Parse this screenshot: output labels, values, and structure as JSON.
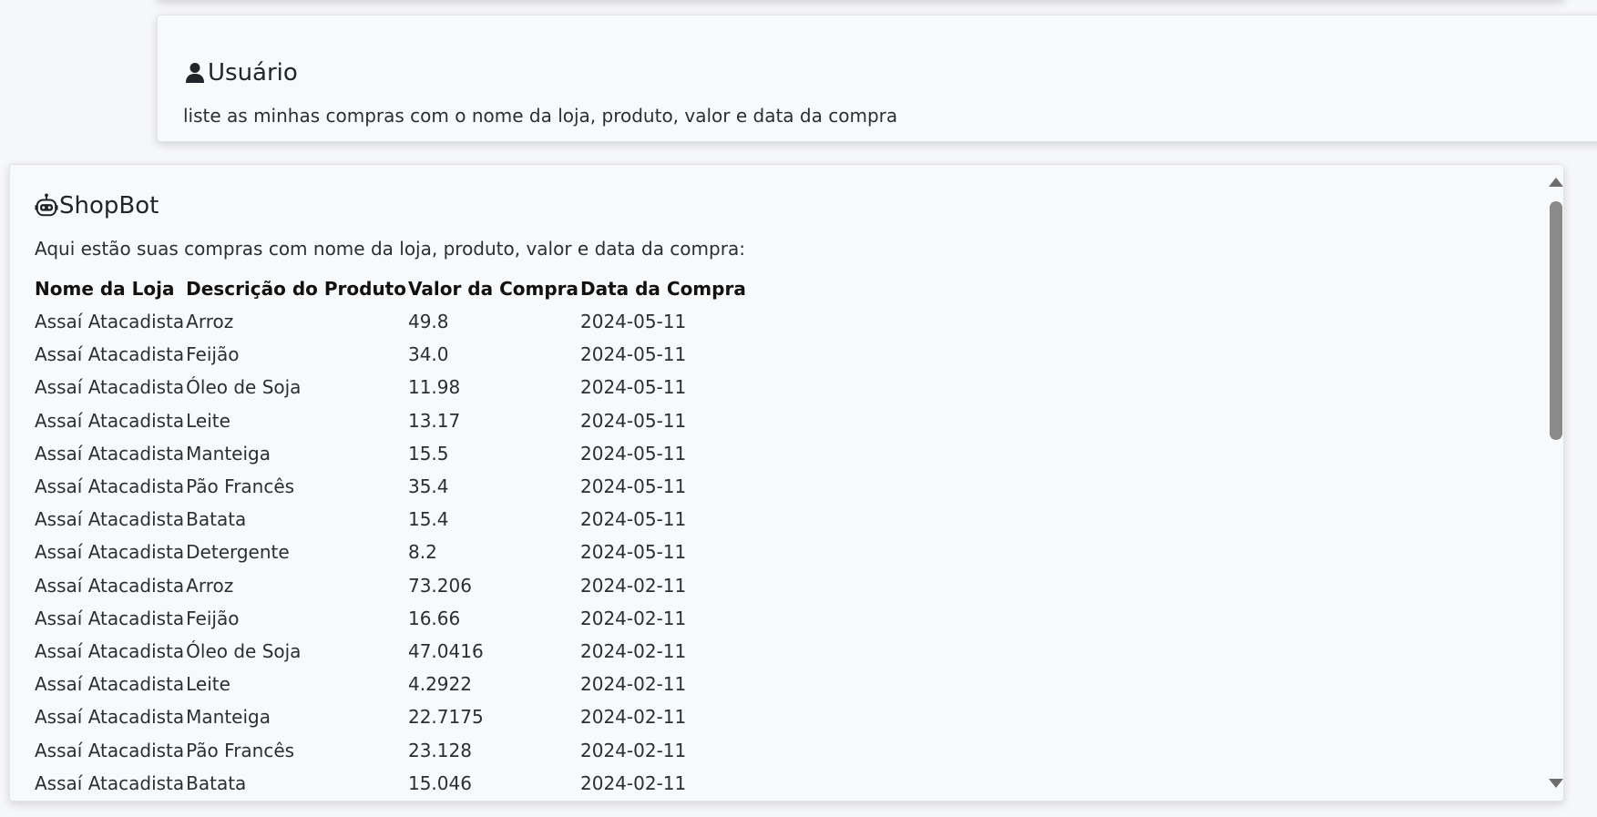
{
  "user_message": {
    "title": "Usuário",
    "text": "liste as minhas compras com o nome da loja, produto, valor e data da compra",
    "icon": "person-icon"
  },
  "bot_message": {
    "title": "ShopBot",
    "text": "Aqui estão suas compras com nome da loja, produto, valor e data da compra:",
    "icon": "robot-icon"
  },
  "purchases_table": {
    "headers": [
      "Nome da Loja",
      "Descrição do Produto",
      "Valor da Compra",
      "Data da Compra"
    ],
    "rows": [
      [
        "Assaí Atacadista",
        "Arroz",
        "49.8",
        "2024-05-11"
      ],
      [
        "Assaí Atacadista",
        "Feijão",
        "34.0",
        "2024-05-11"
      ],
      [
        "Assaí Atacadista",
        "Óleo de Soja",
        "11.98",
        "2024-05-11"
      ],
      [
        "Assaí Atacadista",
        "Leite",
        "13.17",
        "2024-05-11"
      ],
      [
        "Assaí Atacadista",
        "Manteiga",
        "15.5",
        "2024-05-11"
      ],
      [
        "Assaí Atacadista",
        "Pão Francês",
        "35.4",
        "2024-05-11"
      ],
      [
        "Assaí Atacadista",
        "Batata",
        "15.4",
        "2024-05-11"
      ],
      [
        "Assaí Atacadista",
        "Detergente",
        "8.2",
        "2024-05-11"
      ],
      [
        "Assaí Atacadista",
        "Arroz",
        "73.206",
        "2024-02-11"
      ],
      [
        "Assaí Atacadista",
        "Feijão",
        "16.66",
        "2024-02-11"
      ],
      [
        "Assaí Atacadista",
        "Óleo de Soja",
        "47.0416",
        "2024-02-11"
      ],
      [
        "Assaí Atacadista",
        "Leite",
        "4.2922",
        "2024-02-11"
      ],
      [
        "Assaí Atacadista",
        "Manteiga",
        "22.7175",
        "2024-02-11"
      ],
      [
        "Assaí Atacadista",
        "Pão Francês",
        "23.128",
        "2024-02-11"
      ],
      [
        "Assaí Atacadista",
        "Batata",
        "15.046",
        "2024-02-11"
      ]
    ]
  }
}
